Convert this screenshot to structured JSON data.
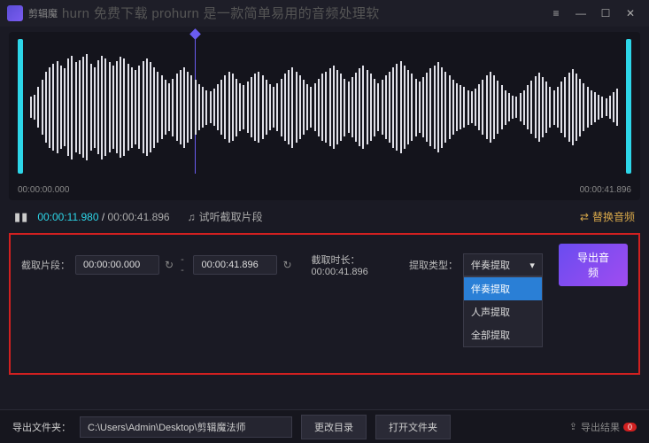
{
  "titlebar": {
    "app_name": "剪辑魔",
    "overlay_watermark": "hurn 免费下载 prohurn 是一款简单易用的音频处理软"
  },
  "waveform": {
    "start_time": "00:00:00.000",
    "end_time": "00:00:41.896"
  },
  "playback": {
    "pause_glyph": "▮▮",
    "current_time": "00:00:11.980",
    "separator": "/",
    "total_time": "00:00:41.896",
    "preview_label": "试听截取片段",
    "replace_label": "替换音频"
  },
  "params": {
    "clip_label": "截取片段：",
    "start_value": "00:00:00.000",
    "dash": "--",
    "end_value": "00:00:41.896",
    "duration_label": "截取时长：",
    "duration_value": "00:00:41.896",
    "extract_label": "提取类型：",
    "extract_selected": "伴奏提取",
    "extract_options": [
      "伴奏提取",
      "人声提取",
      "全部提取"
    ],
    "export_btn": "导出音频"
  },
  "bottombar": {
    "folder_label": "导出文件夹：",
    "folder_path": "C:\\Users\\Admin\\Desktop\\剪辑魔法师",
    "change_dir": "更改目录",
    "open_folder": "打开文件夹",
    "results_label": "导出结果",
    "results_count": "0"
  }
}
